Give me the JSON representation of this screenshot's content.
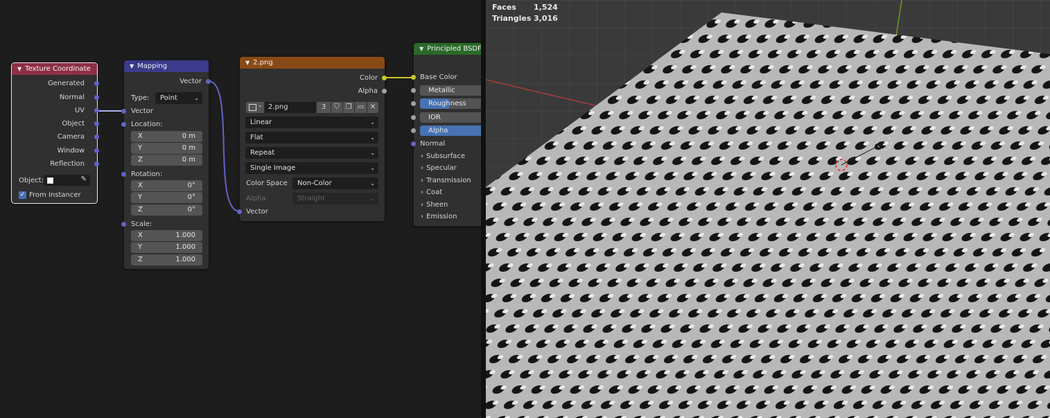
{
  "nodes": {
    "texture_coordinate": {
      "title": "Texture Coordinate",
      "outputs": [
        "Generated",
        "Normal",
        "UV",
        "Object",
        "Camera",
        "Window",
        "Reflection"
      ],
      "object_label": "Object:",
      "from_instancer_label": "From Instancer",
      "from_instancer_checked": true
    },
    "mapping": {
      "title": "Mapping",
      "output": "Vector",
      "type_label": "Type:",
      "type_value": "Point",
      "vector_input": "Vector",
      "location_label": "Location:",
      "location": [
        {
          "axis": "X",
          "value": "0 m"
        },
        {
          "axis": "Y",
          "value": "0 m"
        },
        {
          "axis": "Z",
          "value": "0 m"
        }
      ],
      "rotation_label": "Rotation:",
      "rotation": [
        {
          "axis": "X",
          "value": "0°"
        },
        {
          "axis": "Y",
          "value": "0°"
        },
        {
          "axis": "Z",
          "value": "0°"
        }
      ],
      "scale_label": "Scale:",
      "scale": [
        {
          "axis": "X",
          "value": "1.000"
        },
        {
          "axis": "Y",
          "value": "1.000"
        },
        {
          "axis": "Z",
          "value": "1.000"
        }
      ]
    },
    "image_texture": {
      "title": "2.png",
      "outputs": [
        "Color",
        "Alpha"
      ],
      "image_name": "2.png",
      "users_count": "3",
      "interpolation": "Linear",
      "projection": "Flat",
      "extension": "Repeat",
      "source": "Single Image",
      "color_space_label": "Color Space",
      "color_space": "Non-Color",
      "alpha_label": "Alpha",
      "alpha_mode": "Straight",
      "vector_input": "Vector"
    },
    "principled_bsdf": {
      "title": "Principled BSDF",
      "base_color": "Base Color",
      "fields": [
        {
          "label": "Metallic",
          "fill": 0
        },
        {
          "label": "Roughness",
          "fill": 0.5
        },
        {
          "label": "IOR",
          "fill": 0
        },
        {
          "label": "Alpha",
          "fill": 1
        }
      ],
      "normal": "Normal",
      "panels": [
        "Subsurface",
        "Specular",
        "Transmission",
        "Coat",
        "Sheen",
        "Emission"
      ]
    }
  },
  "viewport": {
    "stats": [
      {
        "label": "Faces",
        "value": "1,524"
      },
      {
        "label": "Triangles",
        "value": "3,016"
      }
    ]
  },
  "colors": {
    "texture_header": "#8e2f48",
    "mapping_header": "#3b3a8c",
    "image_header": "#8a4a16",
    "bsdf_header": "#2a6a2a",
    "vector_socket": "#6363c7",
    "color_socket": "#c7c729",
    "value_socket": "#a1a1a1",
    "accent": "#4772b3"
  }
}
